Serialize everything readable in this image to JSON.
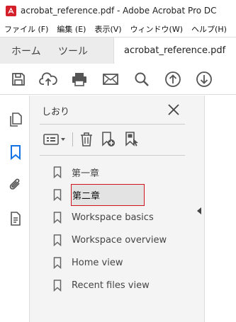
{
  "window": {
    "title": "acrobat_reference.pdf - Adobe Acrobat Pro DC",
    "app_icon": "acrobat-logo-icon",
    "accent_color": "#d4202a"
  },
  "menubar": {
    "items": [
      "ファイル (F)",
      "編集 (E)",
      "表示(V)",
      "ウィンドウ(W)",
      "ヘルプ(H)"
    ]
  },
  "tabs": {
    "home": "ホーム",
    "tools": "ツール",
    "document": "acrobat_reference.pdf"
  },
  "toolbar": {
    "icons": [
      "save-icon",
      "upload-cloud-icon",
      "print-icon",
      "email-icon",
      "search-icon",
      "page-up-icon",
      "page-down-icon"
    ]
  },
  "leftrail": {
    "icons": [
      "pages-icon",
      "bookmark-icon",
      "attachment-icon",
      "document-properties-icon"
    ],
    "active": "bookmark-icon",
    "active_color": "#1473e6"
  },
  "bookmarks_panel": {
    "title": "しおり",
    "tool_icons": [
      "options-menu-icon",
      "delete-icon",
      "new-bookmark-icon",
      "bookmark-search-icon"
    ],
    "items": [
      {
        "label": "第一章",
        "selected": false
      },
      {
        "label": "第二章",
        "selected": true
      },
      {
        "label": "Workspace basics",
        "selected": false
      },
      {
        "label": "Workspace overview",
        "selected": false
      },
      {
        "label": "Home view",
        "selected": false
      },
      {
        "label": "Recent files view",
        "selected": false
      }
    ],
    "selection_color": "#d0141e"
  }
}
